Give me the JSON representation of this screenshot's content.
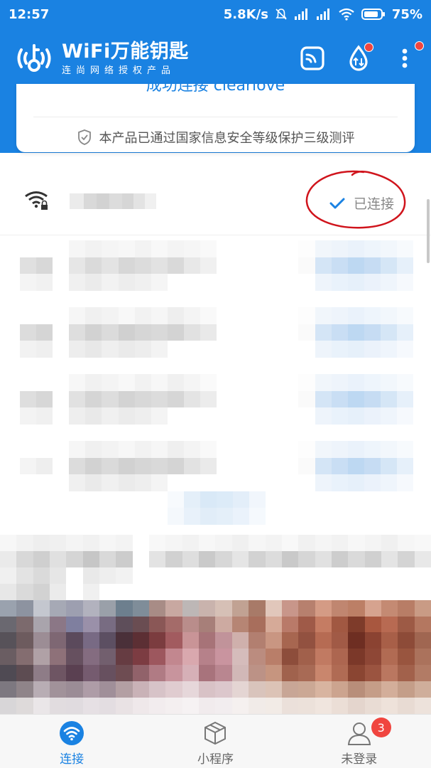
{
  "status_bar": {
    "time": "12:57",
    "net_speed": "5.8K/s",
    "battery": "75%"
  },
  "header": {
    "app_name": "WiFi万能钥匙",
    "tagline": "连尚网络授权产品"
  },
  "card": {
    "partial_text": "成功连接 clearlove",
    "cert_text": "本产品已通过国家信息安全等级保护三级测评"
  },
  "connected_network": {
    "status": "已连接"
  },
  "bottom_nav": {
    "tabs": [
      {
        "label": "连接",
        "icon": "wifi-icon",
        "active": true
      },
      {
        "label": "小程序",
        "icon": "cube-icon",
        "active": false
      },
      {
        "label": "未登录",
        "icon": "user-icon",
        "active": false,
        "badge": "3"
      }
    ]
  },
  "colors": {
    "brand_blue": "#1a82e2",
    "badge_red": "#f0453f",
    "annotation_red": "#d0141c"
  }
}
